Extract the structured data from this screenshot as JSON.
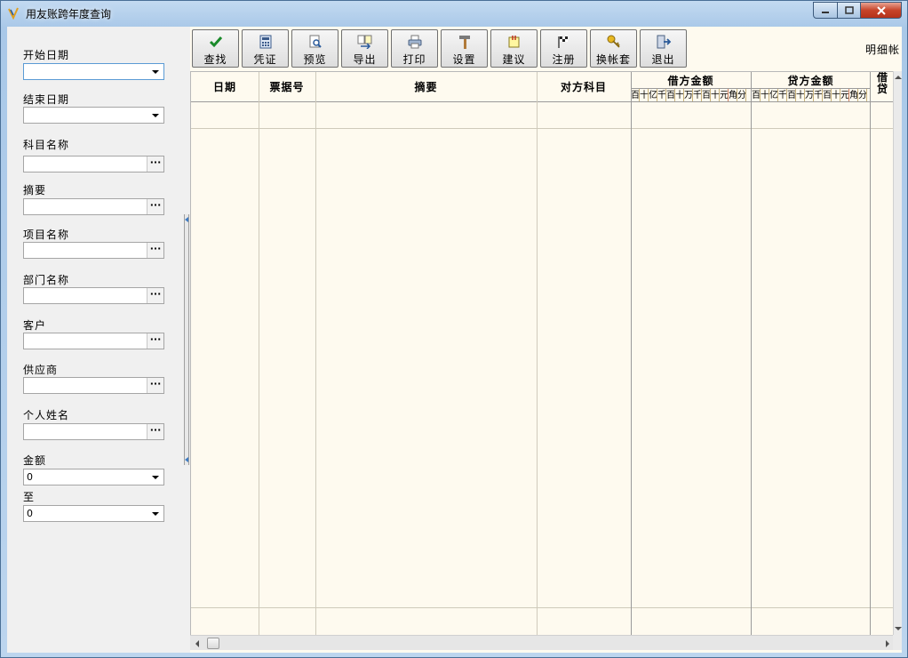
{
  "window": {
    "title": "用友账跨年度查询"
  },
  "filters": {
    "start_date": {
      "label": "开始日期",
      "value": ""
    },
    "end_date": {
      "label": "结束日期",
      "value": ""
    },
    "subject_name": {
      "label": "科目名称",
      "value": ""
    },
    "summary": {
      "label": "摘要",
      "value": ""
    },
    "project_name": {
      "label": "项目名称",
      "value": ""
    },
    "department_name": {
      "label": "部门名称",
      "value": ""
    },
    "customer": {
      "label": "客户",
      "value": ""
    },
    "supplier": {
      "label": "供应商",
      "value": ""
    },
    "person_name": {
      "label": "个人姓名",
      "value": ""
    },
    "amount": {
      "label": "金额",
      "value": "0"
    },
    "amount_to": {
      "label": "至",
      "value": "0"
    },
    "ellipsis": "···"
  },
  "toolbar": {
    "find": "查找",
    "voucher": "凭证",
    "preview": "预览",
    "export": "导出",
    "print": "打印",
    "settings": "设置",
    "suggest": "建议",
    "register": "注册",
    "switch_account": "换帐套",
    "exit": "退出",
    "mode": "明细帐"
  },
  "grid": {
    "columns": {
      "date": "日期",
      "voucher_no": "票据号",
      "summary": "摘要",
      "counter_account": "对方科目",
      "debit": "借方金额",
      "credit": "贷方金额",
      "direction": "借贷"
    },
    "debit_digits": [
      "百",
      "十",
      "亿",
      "千",
      "百",
      "十",
      "万",
      "千",
      "百",
      "十",
      "元",
      "角",
      "分"
    ],
    "credit_digits": [
      "百",
      "十",
      "亿",
      "千",
      "百",
      "十",
      "万",
      "千",
      "百",
      "十",
      "元",
      "角",
      "分"
    ]
  },
  "colors": {
    "grid_bg": "#fefaef",
    "panel_bg": "#f0f0f0",
    "accent": "#3e7bc2"
  },
  "icons": {
    "find": "checkmark-icon",
    "voucher": "calculator-icon",
    "preview": "magnifier-page-icon",
    "export": "export-pages-icon",
    "print": "printer-icon",
    "settings": "hammer-icon",
    "suggest": "note-icon",
    "register": "flag-icon",
    "switch_account": "key-icon",
    "exit": "exit-door-icon"
  }
}
